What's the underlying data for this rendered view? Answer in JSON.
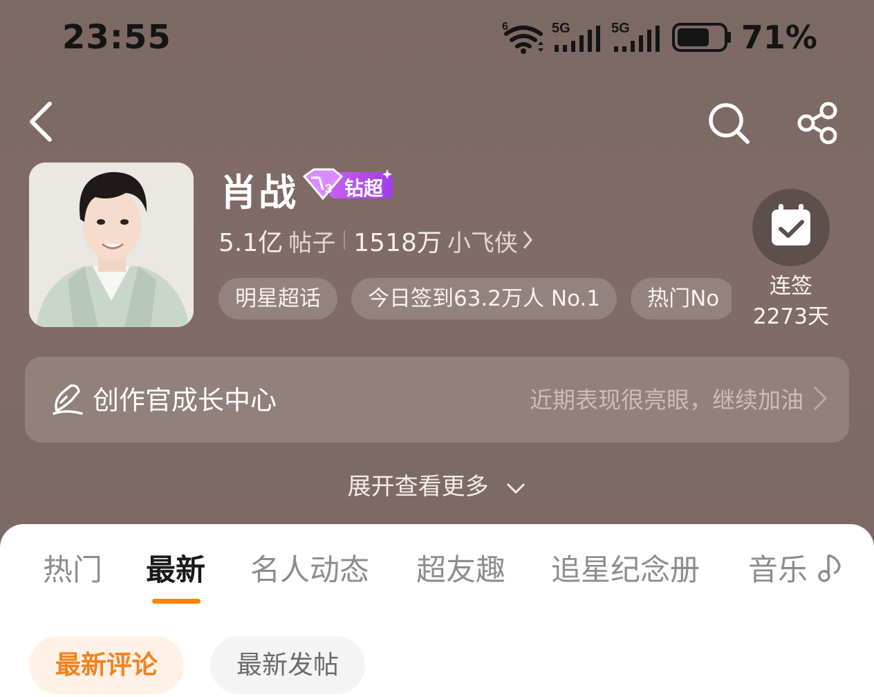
{
  "status_bar": {
    "time": "23:55",
    "battery_percent": "71%",
    "signal_1_label": "5G",
    "signal_2_label": "5G",
    "wifi_label": "6",
    "battery_level": 0.71
  },
  "topic": {
    "name": "肖战",
    "badge_label": "钻超",
    "badge_level": "3",
    "posts_count": "5.1亿",
    "posts_unit": "帖子",
    "fans_count": "1518万",
    "fans_unit": "小飞侠",
    "chips": [
      "明星超话",
      "今日签到63.2万人 No.1",
      "热门No"
    ]
  },
  "checkin": {
    "label": "连签",
    "days": "2273天"
  },
  "creator_center": {
    "title": "创作官成长中心",
    "subtitle": "近期表现很亮眼，继续加油"
  },
  "expand_label": "展开查看更多",
  "tabs": [
    "热门",
    "最新",
    "名人动态",
    "超友趣",
    "追星纪念册",
    "音乐"
  ],
  "active_tab": "最新",
  "filters": {
    "active": "最新评论",
    "inactive": "最新发帖"
  },
  "colors": {
    "accent": "#ff8200",
    "hero_bg": "#7e6a64",
    "vip_purple": "#b44cf0"
  }
}
